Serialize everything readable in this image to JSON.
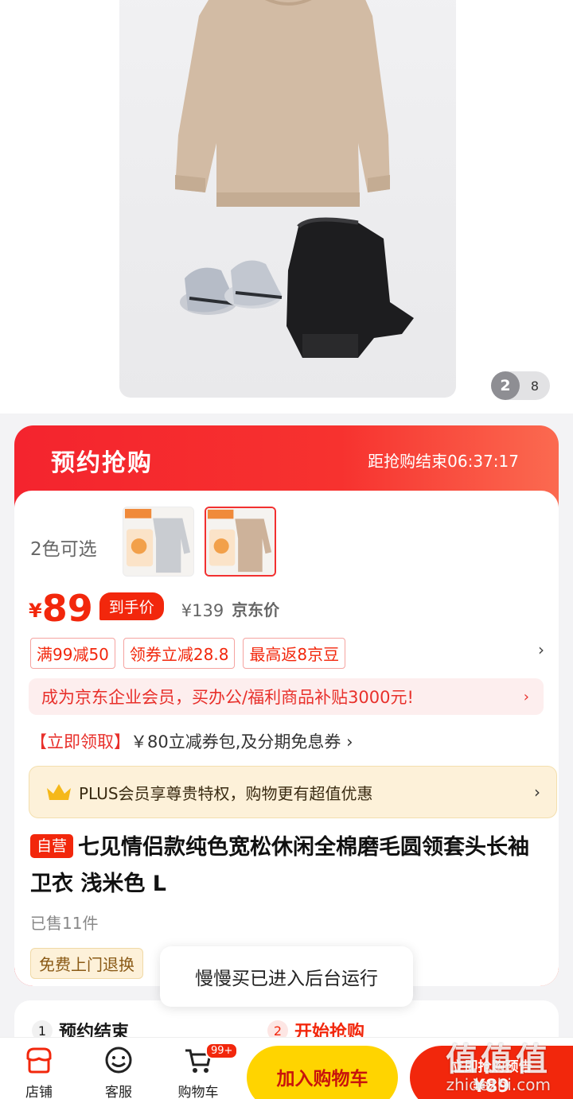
{
  "gallery": {
    "current_page": "2",
    "total_pages": "8"
  },
  "flash_sale": {
    "title": "预约抢购",
    "countdown": "距抢购结束06:37:17"
  },
  "colors": {
    "label": "2色可选"
  },
  "price": {
    "currency": "¥",
    "value": "89",
    "net_badge": "到手价",
    "original": "¥139",
    "original_label": "京东价"
  },
  "coupons": [
    "满99减50",
    "领券立减28.8",
    "最高返8京豆"
  ],
  "enterprise": {
    "text": "成为京东企业会员，买办公/福利商品补贴3000元!"
  },
  "claim": {
    "highlight": "【立即领取】",
    "text": "￥80立减券包,及分期免息券"
  },
  "plus": {
    "text": "PLUS会员享尊贵特权，购物更有超值优惠"
  },
  "product": {
    "self_badge": "自营",
    "title": "七见情侣款纯色宽松休闲全棉磨毛圆领套头长袖卫衣 浅米色 L",
    "sold": "已售11件",
    "service": "免费上门退换"
  },
  "toast": "慢慢买已进入后台运行",
  "steps": [
    {
      "num": "1",
      "label": "预约结束"
    },
    {
      "num": "2",
      "label": "开始抢购"
    }
  ],
  "bottom_bar": {
    "shop": "店铺",
    "service": "客服",
    "cart": "购物车",
    "cart_badge": "99+",
    "add_to_cart": "加入购物车",
    "buy_line1": "立即抢购预告",
    "buy_line2": "¥89"
  },
  "watermark": {
    "logo": "值值值",
    "site": "zhidezhi.com"
  },
  "accent_colors": {
    "red": "#f2270c",
    "yellow": "#ffd400",
    "gold_bg": "#fdf1d9"
  }
}
